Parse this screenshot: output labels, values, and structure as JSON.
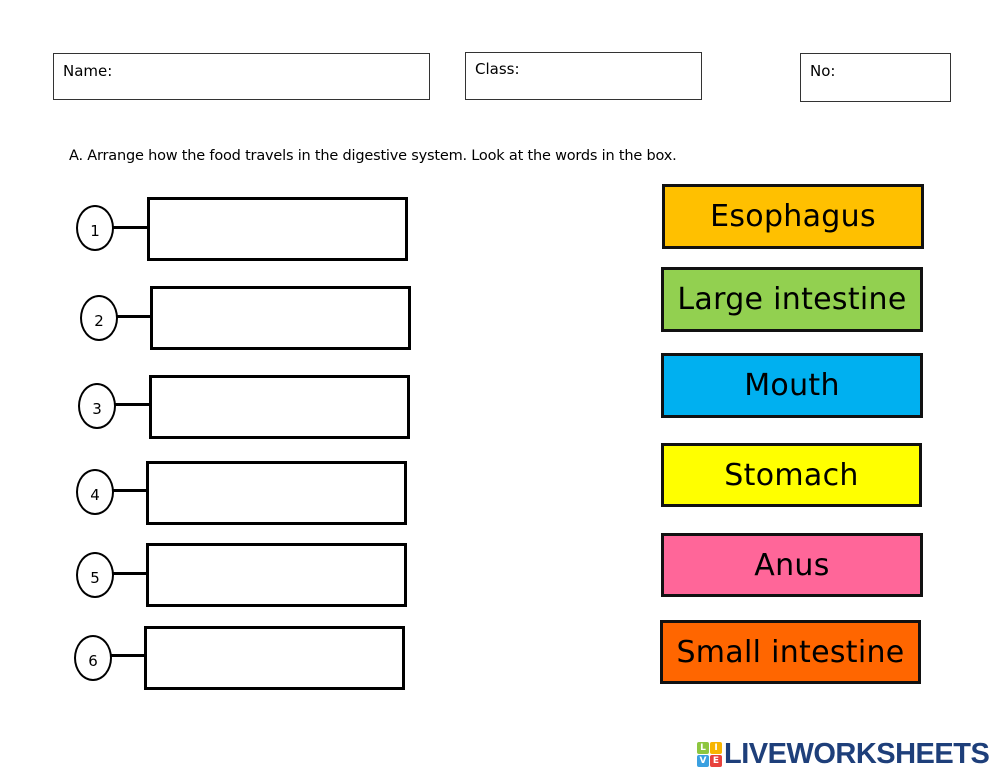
{
  "header": {
    "name_label": "Name:",
    "class_label": "Class:",
    "no_label": "No:"
  },
  "instruction": "A. Arrange how the food travels in the digestive system. Look at the words in the box.",
  "answers": [
    {
      "number": "1",
      "value": ""
    },
    {
      "number": "2",
      "value": ""
    },
    {
      "number": "3",
      "value": ""
    },
    {
      "number": "4",
      "value": ""
    },
    {
      "number": "5",
      "value": ""
    },
    {
      "number": "6",
      "value": ""
    }
  ],
  "word_bank": [
    {
      "label": "Esophagus",
      "color": "#ffc000"
    },
    {
      "label": "Large intestine",
      "color": "#92d050"
    },
    {
      "label": "Mouth",
      "color": "#00b0f0"
    },
    {
      "label": "Stomach",
      "color": "#ffff00"
    },
    {
      "label": "Anus",
      "color": "#ff6699"
    },
    {
      "label": "Small intestine",
      "color": "#ff6600"
    }
  ],
  "logo": {
    "text": "LIVEWORKSHEETS",
    "tiles": [
      {
        "letter": "L",
        "color": "#8dc63f"
      },
      {
        "letter": "I",
        "color": "#f7b500"
      },
      {
        "letter": "V",
        "color": "#3aa0e0"
      },
      {
        "letter": "E",
        "color": "#e8413c"
      }
    ]
  }
}
